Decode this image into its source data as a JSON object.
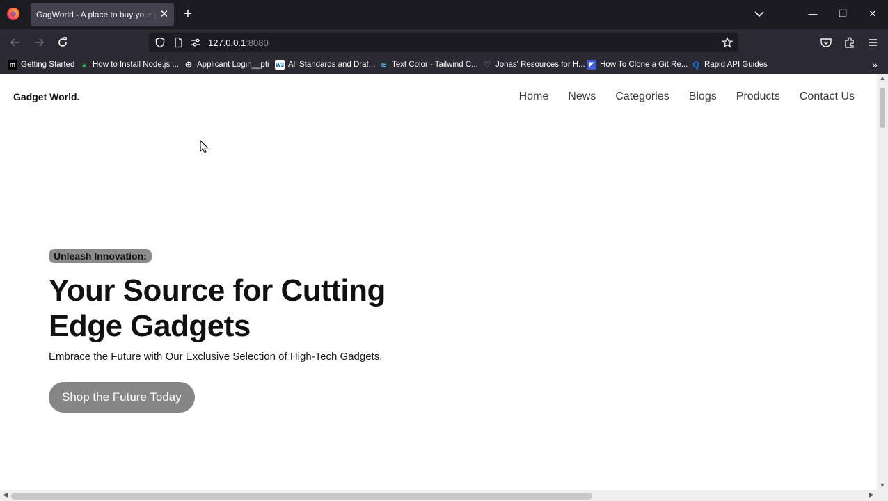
{
  "browser": {
    "tab_title": "GagWorld - A place to buy your gadgets",
    "tab_close": "✕",
    "new_tab": "+",
    "url_host": "127.0.0.1",
    "url_port": ":8080",
    "window_controls": {
      "minimize": "—",
      "restore": "❐",
      "close": "✕"
    },
    "bookmarks_more": "»",
    "bookmarks": [
      {
        "label": "Getting Started",
        "icon": "m",
        "icon_name": "medium-icon"
      },
      {
        "label": "How to Install Node.js ...",
        "icon": "▲",
        "icon_name": "drive-icon"
      },
      {
        "label": "Applicant Login__pti",
        "icon": "⊕",
        "icon_name": "globe-icon"
      },
      {
        "label": "All Standards and Draf...",
        "icon": "W3",
        "icon_name": "w3c-icon"
      },
      {
        "label": "Text Color - Tailwind C...",
        "icon": "≈",
        "icon_name": "tailwind-icon"
      },
      {
        "label": "Jonas' Resources for H...",
        "icon": "♡",
        "icon_name": "heart-icon"
      },
      {
        "label": "How To Clone a Git Re...",
        "icon": "◩",
        "icon_name": "page-icon"
      },
      {
        "label": "Rapid API Guides",
        "icon": "Q",
        "icon_name": "rapidapi-icon"
      }
    ]
  },
  "site": {
    "logo": "Gadget World.",
    "nav": [
      "Home",
      "News",
      "Categories",
      "Blogs",
      "Products",
      "Contact Us"
    ],
    "hero": {
      "badge": "Unleash Innovation:",
      "title_line1": "Your Source for Cutting",
      "title_line2": "Edge Gadgets",
      "subtitle": "Embrace the Future with Our Exclusive Selection of High-Tech Gadgets.",
      "cta": "Shop the Future Today"
    }
  },
  "colors": {
    "browser_bg": "#1c1b22",
    "toolbar_bg": "#2b2a33",
    "active_tab": "#42414d",
    "badge_bg": "#8b8b8b",
    "cta_bg": "#858585"
  }
}
